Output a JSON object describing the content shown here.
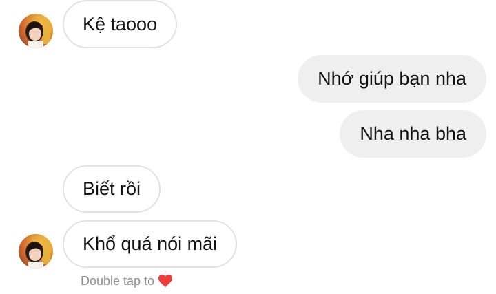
{
  "messages": [
    {
      "from": "them",
      "text": "Kệ taooo",
      "show_avatar": true
    },
    {
      "from": "me",
      "text": "Nhớ giúp bạn nha"
    },
    {
      "from": "me",
      "text": "Nha nha bha"
    },
    {
      "from": "them",
      "text": "Biết rồi",
      "show_avatar": false
    },
    {
      "from": "them",
      "text": "Khổ quá nói mãi",
      "show_avatar": true
    }
  ],
  "hint": {
    "text": "Double tap to",
    "icon": "heart-icon"
  },
  "colors": {
    "incoming_border": "#e2e2e2",
    "outgoing_bg": "#efefef",
    "hint_text": "#8e8e8e",
    "heart": "#ed3b3b"
  }
}
